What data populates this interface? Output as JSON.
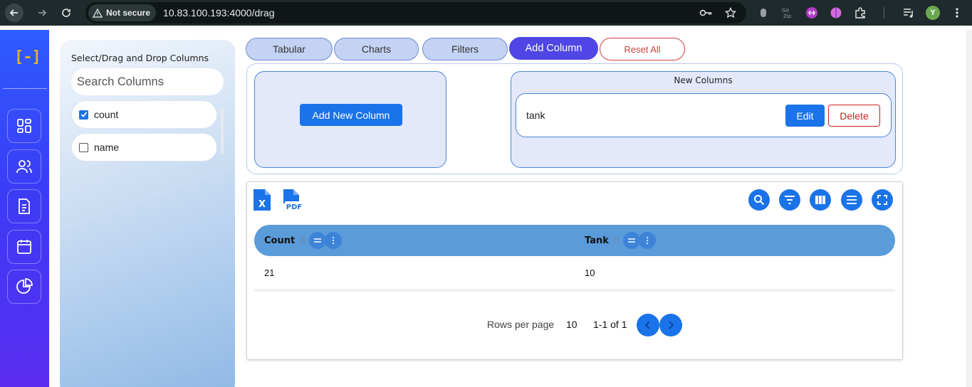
{
  "browser": {
    "security_label": "Not secure",
    "url": "10.83.100.193:4000/drag",
    "profile_initial": "Y"
  },
  "sidebar": {
    "logo_text": "[-]",
    "items": [
      {
        "icon": "dashboard-icon"
      },
      {
        "icon": "users-icon"
      },
      {
        "icon": "document-icon"
      },
      {
        "icon": "calendar-icon"
      },
      {
        "icon": "pie-chart-icon"
      }
    ]
  },
  "columns_panel": {
    "title": "Select/Drag and Drop Columns",
    "search_placeholder": "Search Columns",
    "columns": [
      {
        "label": "count",
        "checked": true
      },
      {
        "label": "name",
        "checked": false
      }
    ]
  },
  "tabs": {
    "tabular": "Tabular",
    "charts": "Charts",
    "filters": "Filters",
    "add_column": "Add Column",
    "reset_all": "Reset All"
  },
  "add_column": {
    "add_new_button": "Add New Column",
    "new_columns_title": "New Columns",
    "new_columns": [
      {
        "name": "tank",
        "edit_label": "Edit",
        "delete_label": "Delete"
      }
    ]
  },
  "table": {
    "export_excel_label": "X",
    "export_pdf_label": "PDF",
    "headers": [
      "Count",
      "Tank"
    ],
    "rows": [
      [
        "21",
        "10"
      ]
    ],
    "rows_per_page_label": "Rows per page",
    "rows_per_page_value": "10",
    "page_range": "1-1 of 1"
  },
  "colors": {
    "accent": "#1a73e8",
    "active_tab": "#4f46e5",
    "danger": "#d02020",
    "header_row": "#5a9bd9"
  }
}
